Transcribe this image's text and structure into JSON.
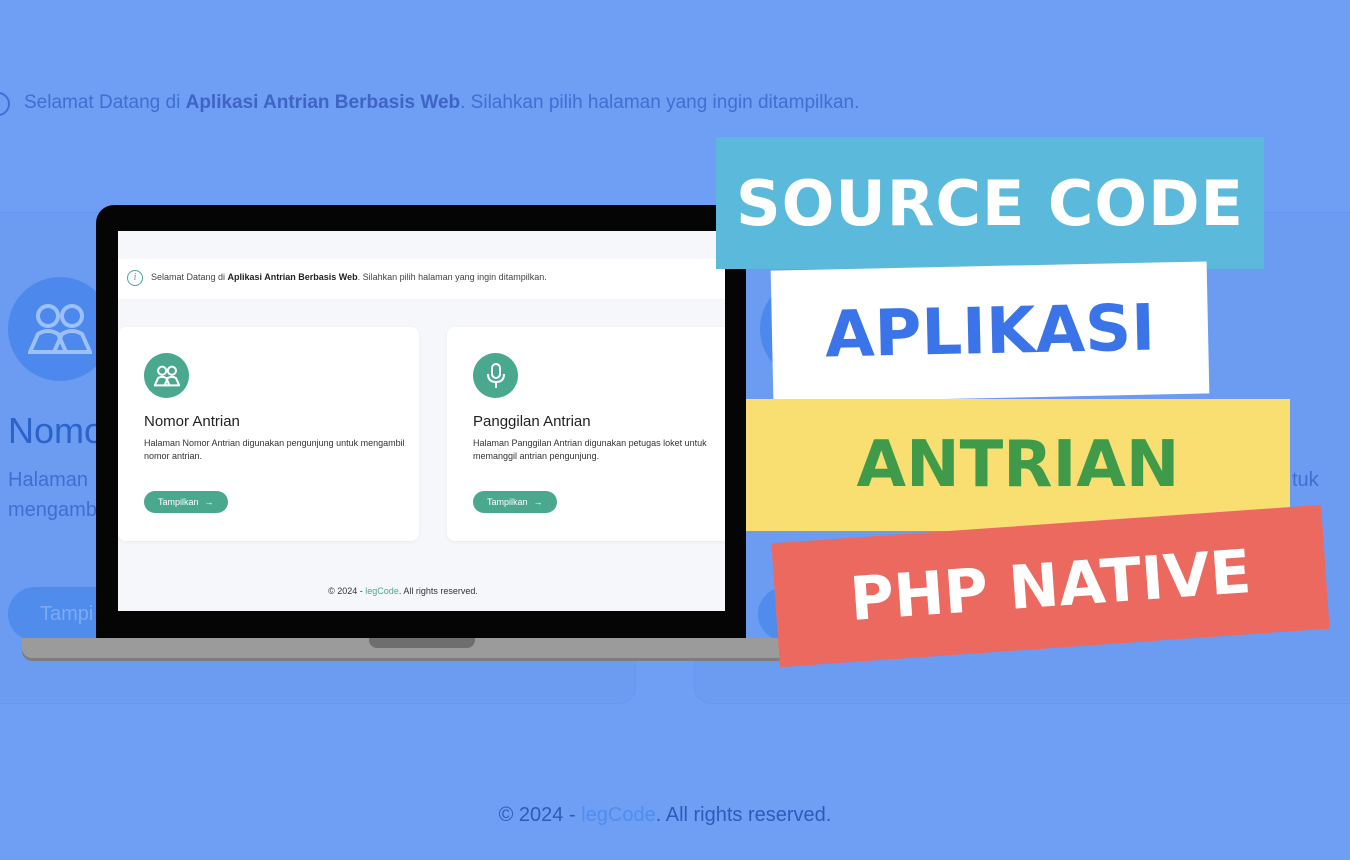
{
  "background": {
    "alert": {
      "prefix": "Selamat Datang di ",
      "bold": "Aplikasi Antrian Berbasis Web",
      "suffix": ". Silahkan pilih halaman yang ingin ditampilkan."
    },
    "card_left": {
      "title": "Nomo",
      "desc_line1": "Halaman",
      "desc_line2": "mengambi",
      "button": "Tampi"
    },
    "card_right": {
      "desc_tail": "tuk"
    },
    "footer": {
      "prefix": "© 2024 - ",
      "brand": "legCode",
      "suffix": ". All rights reserved."
    }
  },
  "screen": {
    "alert": {
      "prefix": "Selamat Datang di ",
      "bold": "Aplikasi Antrian Berbasis Web",
      "suffix": ". Silahkan pilih halaman yang ingin ditampilkan."
    },
    "cards": [
      {
        "icon": "users-icon",
        "title": "Nomor Antrian",
        "desc": "Halaman Nomor Antrian digunakan pengunjung untuk mengambil nomor antrian.",
        "button": "Tampilkan"
      },
      {
        "icon": "microphone-icon",
        "title": "Panggilan Antrian",
        "desc": "Halaman Panggilan Antrian digunakan petugas loket untuk memanggil antrian pengunjung.",
        "button": "Tampilkan"
      }
    ],
    "footer": {
      "prefix": "© 2024 - ",
      "brand": "legCode",
      "suffix": ". All rights reserved."
    }
  },
  "banners": [
    "SOURCE CODE",
    "APLIKASI",
    "ANTRIAN",
    "PHP NATIVE"
  ],
  "colors": {
    "background": "#6f9ef5",
    "accent_green": "#4aa88f",
    "banner_blue": "#5bbadc",
    "banner_white": "#ffffff",
    "banner_yellow": "#f9df72",
    "banner_red": "#ec6960"
  }
}
